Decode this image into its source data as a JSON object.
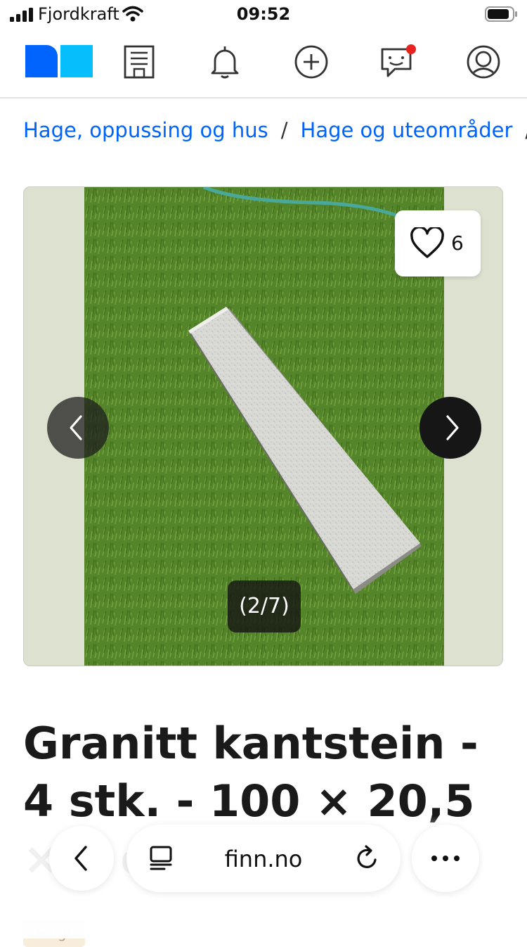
{
  "status_bar": {
    "carrier": "Fjordkraft",
    "time": "09:52",
    "icons": [
      "signal-icon",
      "wifi-icon",
      "battery-icon"
    ]
  },
  "top_nav": {
    "logo": "finn-logo",
    "icons": [
      "building-icon",
      "bell-icon",
      "plus-circle-icon",
      "chat-icon",
      "profile-icon"
    ],
    "chat_has_notification": true,
    "colors": {
      "logo_dark": "#0063fb",
      "logo_light": "#06befb",
      "notification": "#e8231f"
    }
  },
  "breadcrumb": {
    "items": [
      "Hage, oppussing og hus",
      "Hage og uteområder"
    ],
    "separator": "/"
  },
  "gallery": {
    "favorite_count": "6",
    "counter": "(2/7)"
  },
  "listing": {
    "title": "Granitt kantstein - 4 stk. - 100 × 20,5 × 8 cm",
    "status_badge": "Solgt"
  },
  "browser_bar": {
    "domain": "finn.no",
    "icons": [
      "back-icon",
      "reader-icon",
      "reload-icon",
      "more-icon"
    ]
  }
}
